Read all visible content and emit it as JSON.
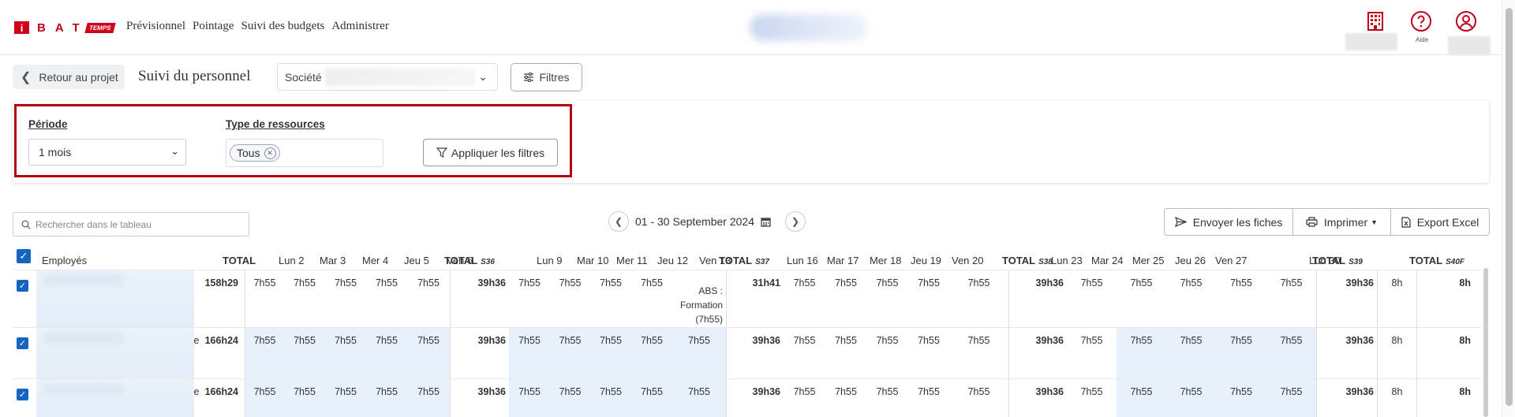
{
  "header": {
    "logo_letter": "i",
    "logo_text": "BAT",
    "logo_badge": "TEMPS",
    "nav": [
      "Prévisionnel",
      "Pointage",
      "Suivi des budgets",
      "Administrer"
    ],
    "icons": {
      "building": "building-icon",
      "help_label": "Aide"
    }
  },
  "toolbar": {
    "back_label": "Retour au projet",
    "title": "Suivi du personnel",
    "company_label": "Société",
    "filters_label": "Filtres"
  },
  "filter_panel": {
    "period_label": "Période",
    "period_value": "1 mois",
    "resource_label": "Type de ressources",
    "resource_chip": "Tous",
    "apply_label": "Appliquer les filtres"
  },
  "table_toolbar": {
    "search_placeholder": "Rechercher dans le tableau",
    "date_range": "01 - 30 September 2024",
    "send_label": "Envoyer les fiches",
    "print_label": "Imprimer",
    "export_label": "Export Excel"
  },
  "table": {
    "employees_header": "Employés",
    "total_header": "TOTAL",
    "columns": [
      {
        "label": "Lun 2"
      },
      {
        "label": "Mar 3"
      },
      {
        "label": "Mer 4"
      },
      {
        "label": "Jeu 5"
      },
      {
        "label": "Ven 6"
      },
      {
        "label": "TOTAL",
        "week": "S36"
      },
      {
        "label": "Lun 9"
      },
      {
        "label": "Mar 10"
      },
      {
        "label": "Mer 11"
      },
      {
        "label": "Jeu 12"
      },
      {
        "label": "Ven 13"
      },
      {
        "label": "TOTAL",
        "week": "S37"
      },
      {
        "label": "Lun 16"
      },
      {
        "label": "Mar 17"
      },
      {
        "label": "Mer 18"
      },
      {
        "label": "Jeu 19"
      },
      {
        "label": "Ven 20"
      },
      {
        "label": "TOTAL",
        "week": "S38"
      },
      {
        "label": "Lun 23"
      },
      {
        "label": "Mar 24"
      },
      {
        "label": "Mer 25"
      },
      {
        "label": "Jeu 26"
      },
      {
        "label": "Ven 27"
      },
      {
        "label": "TOTAL",
        "week": "S39"
      },
      {
        "label": "Lun 30"
      },
      {
        "label": "TOTAL",
        "week": "S40F"
      }
    ],
    "rows": [
      {
        "partial": "",
        "total": "158h29",
        "cells": [
          "7h55",
          "7h55",
          "7h55",
          "7h55",
          "7h55",
          "39h36",
          "7h55",
          "7h55",
          "7h55",
          "7h55",
          "",
          "31h41",
          "7h55",
          "7h55",
          "7h55",
          "7h55",
          "7h55",
          "39h36",
          "7h55",
          "7h55",
          "7h55",
          "7h55",
          "7h55",
          "39h36",
          "8h",
          "8h"
        ],
        "absence": "ABS : Formation (7h55)"
      },
      {
        "partial": "e",
        "total": "166h24",
        "cells": [
          "7h55",
          "7h55",
          "7h55",
          "7h55",
          "7h55",
          "39h36",
          "7h55",
          "7h55",
          "7h55",
          "7h55",
          "7h55",
          "39h36",
          "7h55",
          "7h55",
          "7h55",
          "7h55",
          "7h55",
          "39h36",
          "7h55",
          "7h55",
          "7h55",
          "7h55",
          "7h55",
          "39h36",
          "8h",
          "8h"
        ]
      },
      {
        "partial": "e",
        "total": "166h24",
        "cells": [
          "7h55",
          "7h55",
          "7h55",
          "7h55",
          "7h55",
          "39h36",
          "7h55",
          "7h55",
          "7h55",
          "7h55",
          "7h55",
          "39h36",
          "7h55",
          "7h55",
          "7h55",
          "7h55",
          "7h55",
          "39h36",
          "7h55",
          "7h55",
          "7h55",
          "7h55",
          "7h55",
          "39h36",
          "8h",
          "8h"
        ]
      }
    ]
  },
  "colors": {
    "brand": "#d0021b",
    "checkbox": "#1565c0",
    "highlight_cell": "#e6f1fb",
    "focus_border": "#b40010"
  }
}
